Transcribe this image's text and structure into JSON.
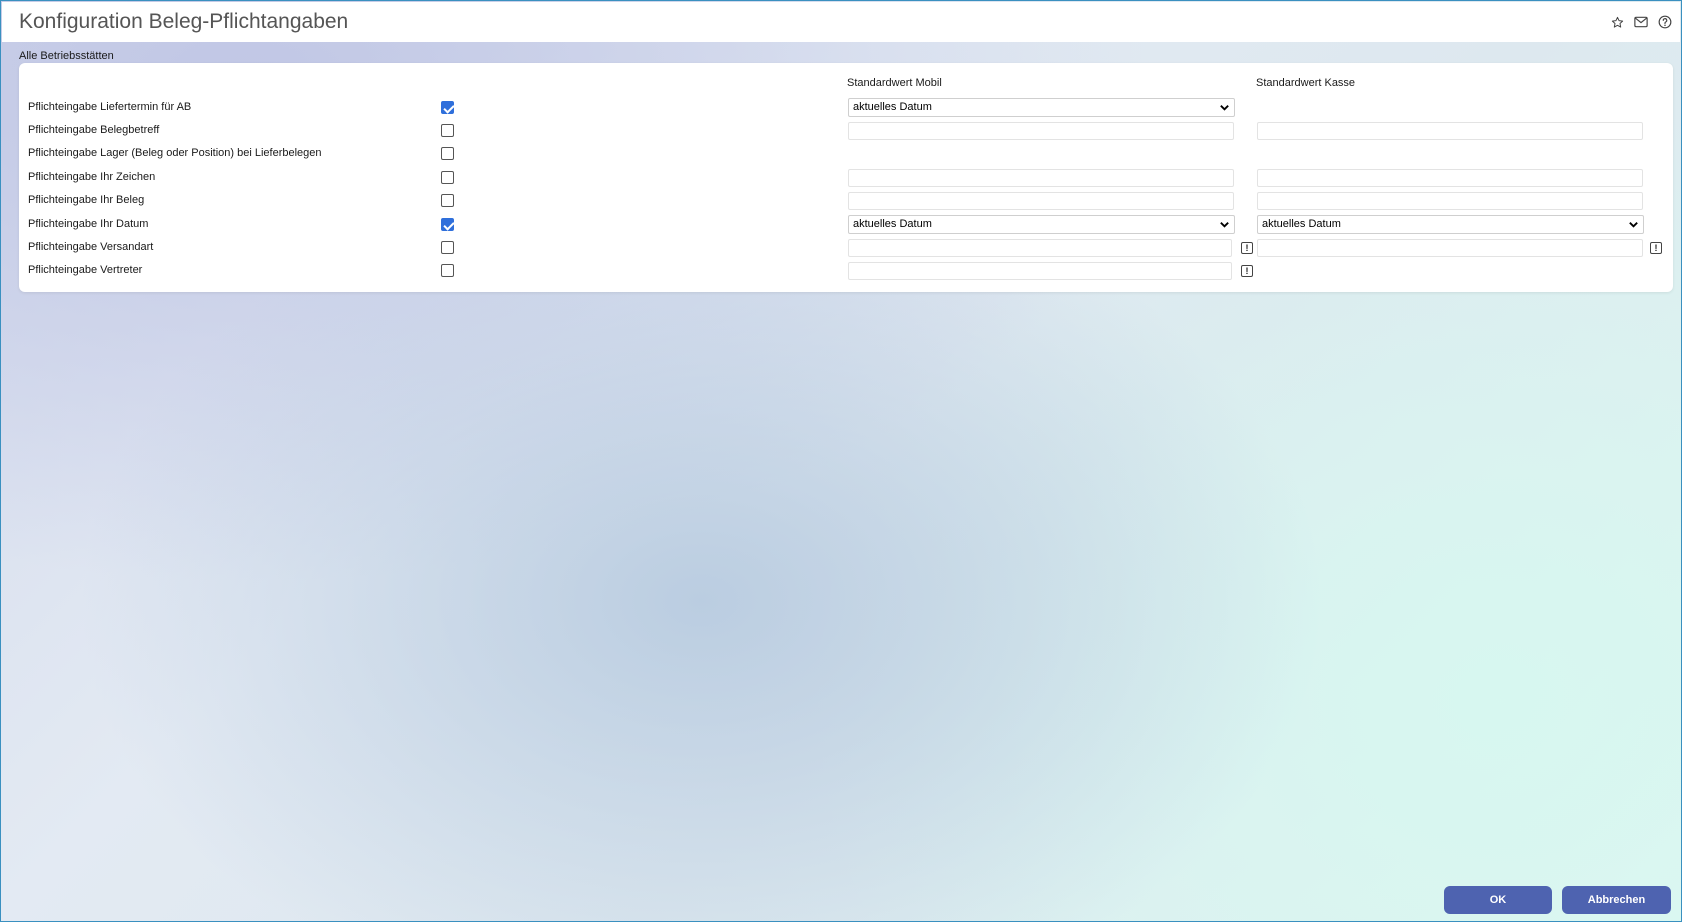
{
  "window": {
    "title": "Konfiguration Beleg-Pflichtangaben"
  },
  "header_icons": [
    "star-icon",
    "mail-icon",
    "help-icon"
  ],
  "scope_label": "Alle Betriebsstätten",
  "columns": {
    "mobil": "Standardwert Mobil",
    "kasse": "Standardwert Kasse"
  },
  "rows": [
    {
      "label": "Pflichteingabe Liefertermin für AB",
      "checked": true,
      "mobil": {
        "type": "select",
        "value": "aktuelles Datum"
      },
      "kasse": null
    },
    {
      "label": "Pflichteingabe Belegbetreff",
      "checked": false,
      "mobil": {
        "type": "input",
        "value": ""
      },
      "kasse": {
        "type": "input",
        "value": ""
      }
    },
    {
      "label": "Pflichteingabe Lager (Beleg oder Position) bei Lieferbelegen",
      "checked": false,
      "mobil": null,
      "kasse": null
    },
    {
      "label": "Pflichteingabe Ihr Zeichen",
      "checked": false,
      "mobil": {
        "type": "input",
        "value": ""
      },
      "kasse": {
        "type": "input",
        "value": ""
      }
    },
    {
      "label": "Pflichteingabe Ihr Beleg",
      "checked": false,
      "mobil": {
        "type": "input",
        "value": ""
      },
      "kasse": {
        "type": "input",
        "value": ""
      }
    },
    {
      "label": "Pflichteingabe Ihr Datum",
      "checked": true,
      "mobil": {
        "type": "select",
        "value": "aktuelles Datum"
      },
      "kasse": {
        "type": "select",
        "value": "aktuelles Datum"
      }
    },
    {
      "label": "Pflichteingabe Versandart",
      "checked": false,
      "mobil": {
        "type": "input-lookup",
        "value": "",
        "button": "!"
      },
      "kasse": {
        "type": "input-lookup",
        "value": "",
        "button": "!"
      }
    },
    {
      "label": "Pflichteingabe Vertreter",
      "checked": false,
      "mobil": {
        "type": "input-lookup",
        "value": "",
        "button": "!"
      },
      "kasse": null
    }
  ],
  "footer": {
    "ok_label": "OK",
    "cancel_label": "Abbrechen"
  },
  "colors": {
    "accent": "#4e63b0",
    "checkbox": "#2f6fdb",
    "frame": "#3a90c0"
  }
}
